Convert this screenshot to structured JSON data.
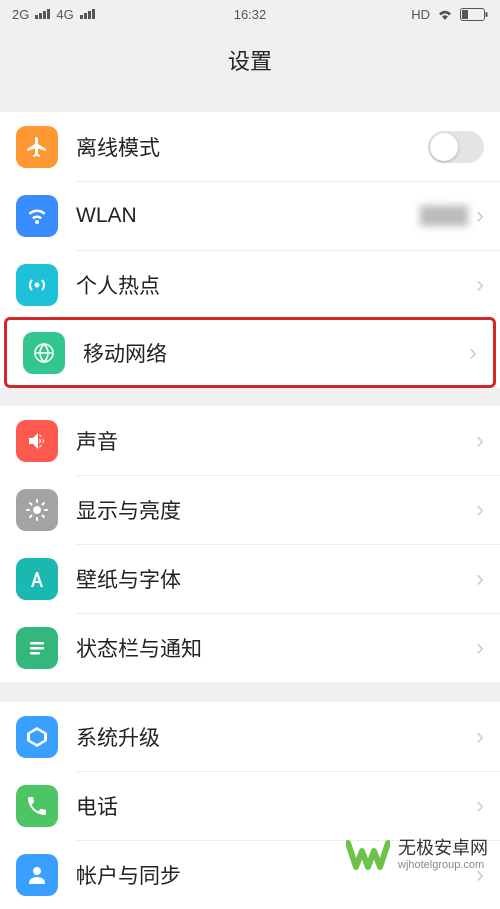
{
  "status": {
    "net1": "2G",
    "net2": "4G",
    "time": "16:32",
    "hd": "HD"
  },
  "header": {
    "title": "设置"
  },
  "sections": [
    {
      "rows": [
        {
          "key": "airplane",
          "label": "离线模式",
          "control": "toggle"
        },
        {
          "key": "wlan",
          "label": "WLAN",
          "value": "████",
          "control": "chevron"
        },
        {
          "key": "hotspot",
          "label": "个人热点",
          "control": "chevron"
        },
        {
          "key": "mobile",
          "label": "移动网络",
          "control": "chevron",
          "highlight": true
        }
      ]
    },
    {
      "rows": [
        {
          "key": "sound",
          "label": "声音",
          "control": "chevron"
        },
        {
          "key": "display",
          "label": "显示与亮度",
          "control": "chevron"
        },
        {
          "key": "wallpaper",
          "label": "壁纸与字体",
          "control": "chevron"
        },
        {
          "key": "notify",
          "label": "状态栏与通知",
          "control": "chevron"
        }
      ]
    },
    {
      "rows": [
        {
          "key": "update",
          "label": "系统升级",
          "control": "chevron"
        },
        {
          "key": "phone",
          "label": "电话",
          "control": "chevron"
        },
        {
          "key": "account",
          "label": "帐户与同步",
          "control": "chevron"
        }
      ]
    }
  ],
  "watermark": {
    "main": "无极安卓网",
    "sub": "wjhotelgroup.com"
  }
}
